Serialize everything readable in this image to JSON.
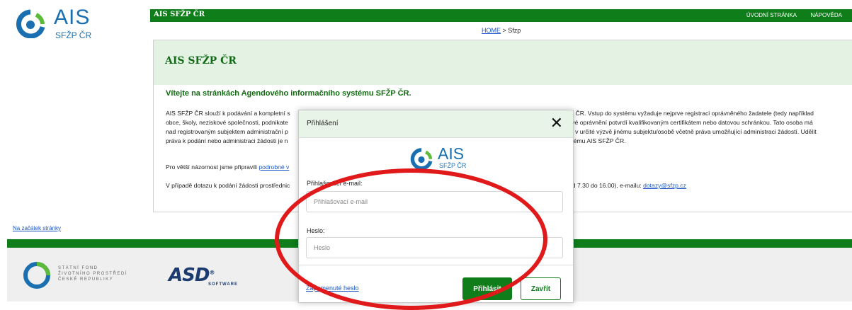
{
  "header": {
    "logo_main": "AIS",
    "logo_sub": "SFŽP ČR",
    "brand": "AIS SFŽP ČR",
    "nav": [
      "ÚVODNÍ STRÁNKA",
      "NÁPOVĚDA"
    ],
    "colors": {
      "primary_green": "#0f7d1a",
      "logo_blue": "#1a6fb0"
    }
  },
  "breadcrumb": {
    "home": "HOME",
    "separator": ">",
    "current": "Sfzp"
  },
  "main": {
    "title": "AIS SFŽP ČR",
    "welcome": "Vítejte na stránkách Agendového informačního systému SFŽP ČR.",
    "para1_left": [
      "AIS SFŽP ČR slouží k podávání a kompletní s",
      "obce, školy, neziskové společnosti, podnikate",
      "nad registrovaným subjektem administrační p",
      "práva k podání nebo administraci žádosti je n"
    ],
    "para1_right": [
      "dí ČR. Vstup do systému vyžaduje nejprve registraci oprávněného žadatele (tedy například",
      "své oprávnění potvrdí kvalifikovaným certifikátem nebo datovou schránkou. Tato osoba má",
      "st v určité výzvě jinému subjektu/osobě včetně práva umožňující administraci žádostí. Udělit",
      "stému AIS SFŽP ČR."
    ],
    "para2_prefix": "Pro větší názornost jsme připravili",
    "para2_link": "podrobné v",
    "para3_left": "V případě dotazu k podání žádosti prostřednic",
    "para3_right": "od 7.30 do 16.00), e-mailu:",
    "para3_email": "dotazy@sfzp.cz"
  },
  "to_top": "Na začátek stránky",
  "footer": {
    "sfzp_text": [
      "STÁTNÍ FOND",
      "ŽIVOTNÍHO PROSTŘEDÍ",
      "ČESKÉ REPUBLIKY"
    ],
    "asd": "ASD",
    "asd_reg": "®",
    "asd_sub": "SOFTWARE"
  },
  "modal": {
    "title": "Přihlášení",
    "close_glyph": "✕",
    "logo_main": "AIS",
    "logo_sub": "SFŽP ČR",
    "email_label": "Přihlašovací e-mail:",
    "email_placeholder": "Přihlašovací e-mail",
    "email_value": "",
    "password_label": "Heslo:",
    "password_placeholder": "Heslo",
    "forgot": "Zapomenuté heslo",
    "login": "Přihlásit",
    "close": "Zavřít"
  },
  "annotation": {
    "ring_color": "#e0191b"
  }
}
